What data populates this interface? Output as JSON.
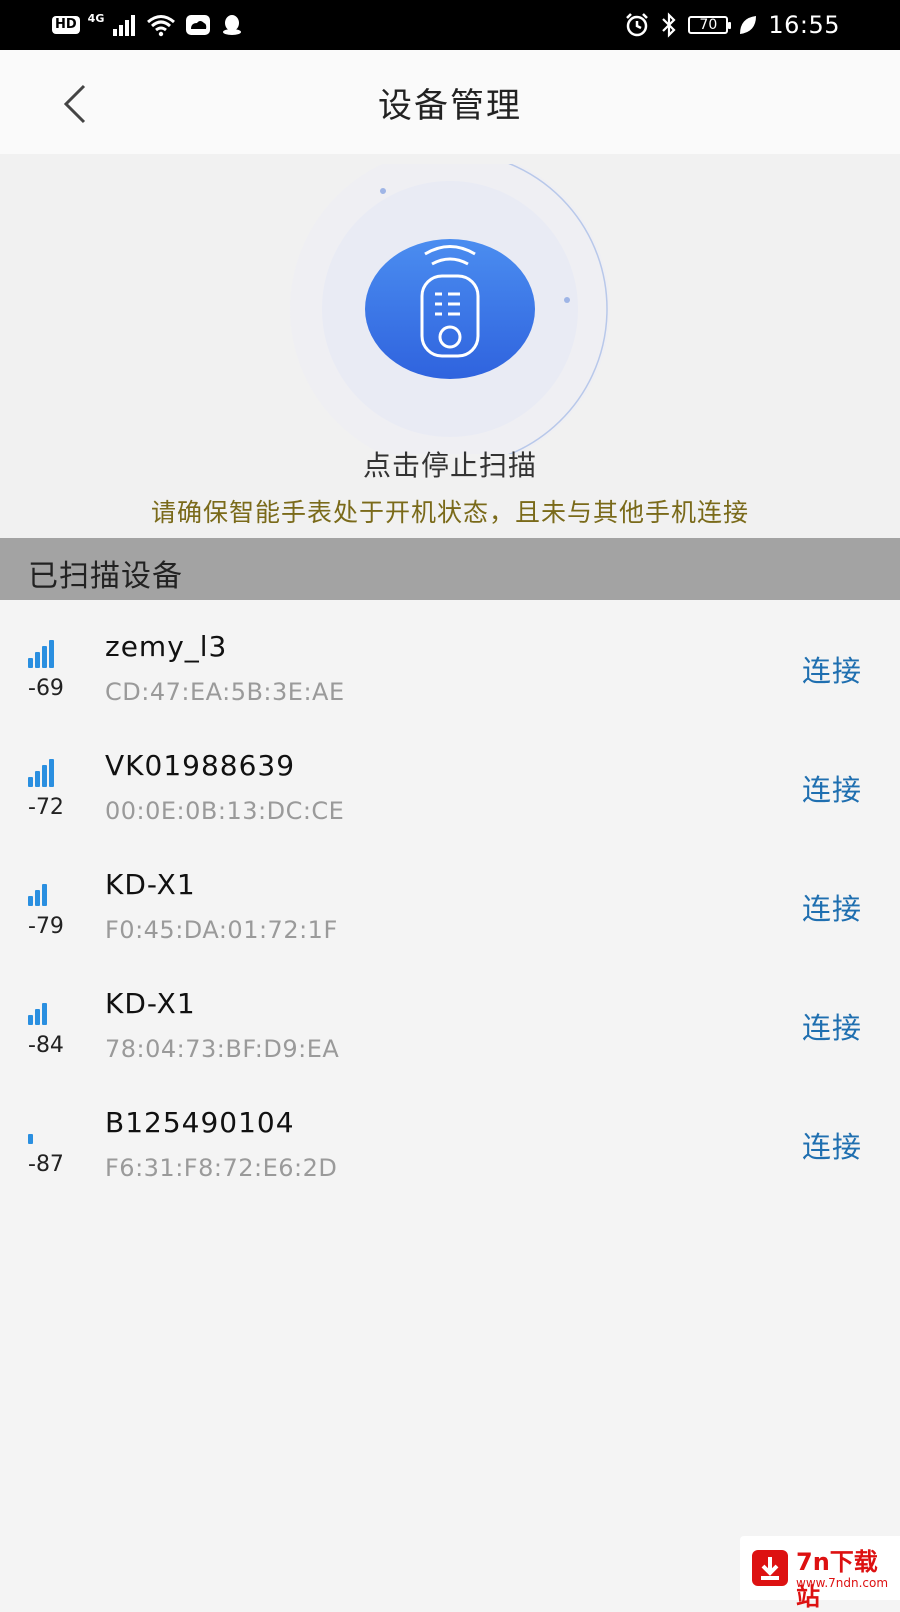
{
  "status_bar": {
    "hd": "HD",
    "network": "4G",
    "battery": "70",
    "time": "16:55"
  },
  "header": {
    "title": "设备管理"
  },
  "scan": {
    "action_text": "点击停止扫描",
    "tip_text": "请确保智能手表处于开机状态，且未与其他手机连接",
    "accent_color": "#3f7de8"
  },
  "section": {
    "title": "已扫描设备"
  },
  "devices": [
    {
      "rssi": "-69",
      "signal_bars": 4,
      "name": "zemy_l3",
      "mac": "CD:47:EA:5B:3E:AE",
      "action": "连接"
    },
    {
      "rssi": "-72",
      "signal_bars": 4,
      "name": "VK01988639",
      "mac": "00:0E:0B:13:DC:CE",
      "action": "连接"
    },
    {
      "rssi": "-79",
      "signal_bars": 3,
      "name": "KD-X1",
      "mac": "F0:45:DA:01:72:1F",
      "action": "连接"
    },
    {
      "rssi": "-84",
      "signal_bars": 3,
      "name": "KD-X1",
      "mac": "78:04:73:BF:D9:EA",
      "action": "连接"
    },
    {
      "rssi": "-87",
      "signal_bars": 1,
      "name": "B125490104",
      "mac": "F6:31:F8:72:E6:2D",
      "action": "连接"
    }
  ],
  "watermark": {
    "main": "7n下载站",
    "sub": "www.7ndn.com"
  }
}
